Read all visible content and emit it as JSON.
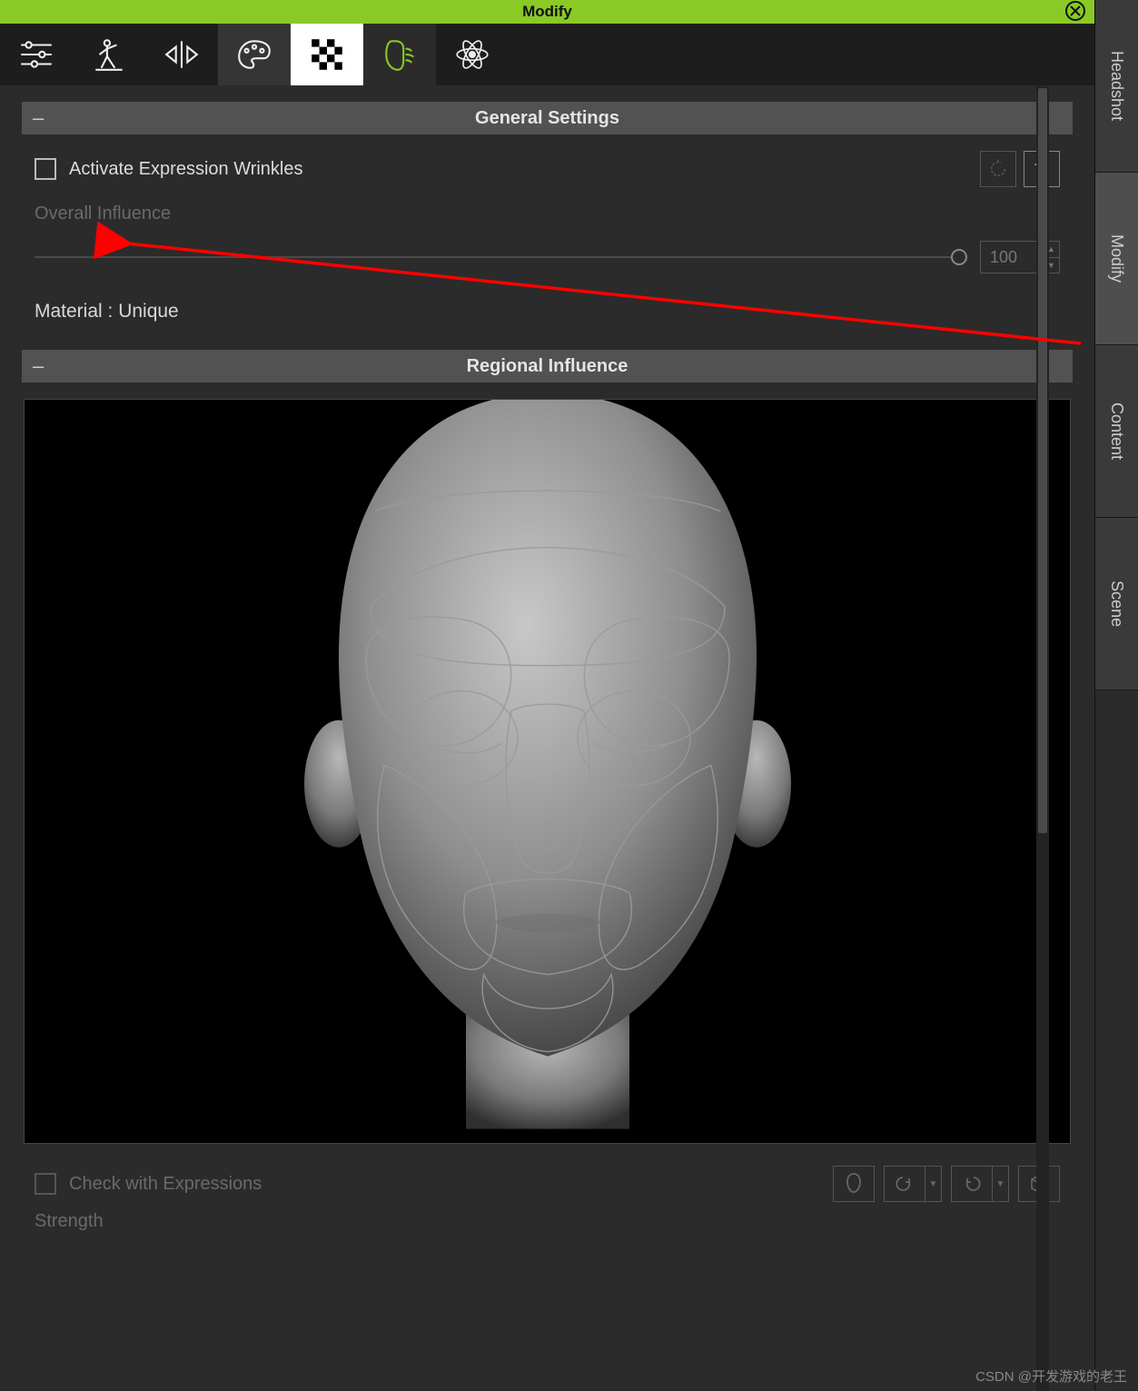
{
  "titlebar": {
    "title": "Modify"
  },
  "right_tabs": [
    "Headshot",
    "Modify",
    "Content",
    "Scene"
  ],
  "right_tab_active_index": 1,
  "sections": {
    "general": {
      "title": "General Settings"
    },
    "regional": {
      "title": "Regional Influence"
    }
  },
  "general": {
    "activate_label": "Activate Expression Wrinkles",
    "activate_checked": false,
    "overall_label": "Overall Influence",
    "overall_value": "100",
    "material_label": "Material : Unique"
  },
  "bottom": {
    "check_label": "Check with Expressions",
    "strength_label": "Strength"
  },
  "watermark": "CSDN @开发游戏的老王"
}
